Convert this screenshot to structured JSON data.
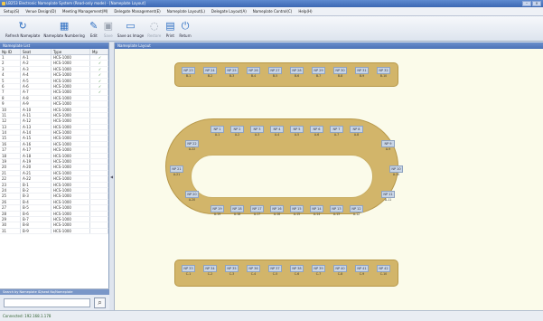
{
  "window": {
    "title": "LB253 Electronic Nameplate System (Read-only mode) - [Nameplate Layout]",
    "controls": [
      "–",
      "×"
    ]
  },
  "menu": [
    "Setup(S)",
    "Venue Design(D)",
    "Meeting Management(M)",
    "Delegate Management(E)",
    "Nameplate Layout(L)",
    "Delegate Layout(A)",
    "Nameplate Control(C)",
    "Help(H)"
  ],
  "toolbar": [
    {
      "label": "Refresh Nameplate",
      "icon": "refresh-icon",
      "glyph": "↻",
      "disabled": false
    },
    {
      "label": "Nameplate Numbering",
      "icon": "numbering-icon",
      "glyph": "▦",
      "disabled": false
    },
    {
      "label": "Edit",
      "icon": "pencil-icon",
      "glyph": "✎",
      "disabled": false
    },
    {
      "label": "Save",
      "icon": "save-icon",
      "glyph": "▣",
      "disabled": true
    },
    {
      "label": "Save as Image",
      "icon": "image-icon",
      "glyph": "▭",
      "disabled": false
    },
    {
      "label": "Restore",
      "icon": "restore-icon",
      "glyph": "◌",
      "disabled": true
    },
    {
      "label": "Print",
      "icon": "printer-icon",
      "glyph": "▤",
      "disabled": false
    },
    {
      "label": "Return",
      "icon": "power-icon",
      "glyph": "⏻",
      "disabled": false
    }
  ],
  "left_panel": {
    "title": "Nameplate List",
    "columns": [
      "Np ID",
      "Seat",
      "Type",
      "Mp"
    ],
    "rows": [
      [
        "1",
        "A-1",
        "HCS-1000",
        "✓"
      ],
      [
        "2",
        "A-2",
        "HCS-1000",
        "✓"
      ],
      [
        "3",
        "A-3",
        "HCS-1000",
        "✓"
      ],
      [
        "4",
        "A-4",
        "HCS-1000",
        "✓"
      ],
      [
        "5",
        "A-5",
        "HCS-1000",
        "✓"
      ],
      [
        "6",
        "A-6",
        "HCS-1000",
        "✓"
      ],
      [
        "7",
        "A-7",
        "HCS-1000",
        "✓"
      ],
      [
        "8",
        "A-8",
        "HCS-1000",
        ""
      ],
      [
        "9",
        "A-9",
        "HCS-1000",
        ""
      ],
      [
        "10",
        "A-10",
        "HCS-1000",
        ""
      ],
      [
        "11",
        "A-11",
        "HCS-1000",
        ""
      ],
      [
        "12",
        "A-12",
        "HCS-1000",
        ""
      ],
      [
        "13",
        "A-13",
        "HCS-1000",
        ""
      ],
      [
        "14",
        "A-14",
        "HCS-1000",
        ""
      ],
      [
        "15",
        "A-15",
        "HCS-1000",
        ""
      ],
      [
        "16",
        "A-16",
        "HCS-1000",
        ""
      ],
      [
        "17",
        "A-17",
        "HCS-1000",
        ""
      ],
      [
        "18",
        "A-18",
        "HCS-1000",
        ""
      ],
      [
        "19",
        "A-19",
        "HCS-1000",
        ""
      ],
      [
        "20",
        "A-20",
        "HCS-1000",
        ""
      ],
      [
        "21",
        "A-21",
        "HCS-1000",
        ""
      ],
      [
        "22",
        "A-22",
        "HCS-1000",
        ""
      ],
      [
        "23",
        "B-1",
        "HCS-1000",
        ""
      ],
      [
        "24",
        "B-2",
        "HCS-1000",
        ""
      ],
      [
        "25",
        "B-3",
        "HCS-1000",
        ""
      ],
      [
        "26",
        "B-4",
        "HCS-1000",
        ""
      ],
      [
        "27",
        "B-5",
        "HCS-1000",
        ""
      ],
      [
        "28",
        "B-6",
        "HCS-1000",
        ""
      ],
      [
        "29",
        "B-7",
        "HCS-1000",
        ""
      ],
      [
        "30",
        "B-8",
        "HCS-1000",
        ""
      ],
      [
        "31",
        "B-9",
        "HCS-1000",
        ""
      ]
    ],
    "search_title": "Search by Nameplate ID/seat No/Nameplate",
    "search_value": ""
  },
  "canvas": {
    "title": "Nameplate Layout",
    "top_row": [
      {
        "id": "NP 23",
        "name": "B-1"
      },
      {
        "id": "NP 24",
        "name": "B-2"
      },
      {
        "id": "NP 25",
        "name": "B-3"
      },
      {
        "id": "NP 26",
        "name": "B-4"
      },
      {
        "id": "NP 27",
        "name": "B-5"
      },
      {
        "id": "NP 28",
        "name": "B-6"
      },
      {
        "id": "NP 29",
        "name": "B-7"
      },
      {
        "id": "NP 30",
        "name": "B-8"
      },
      {
        "id": "NP 31",
        "name": "B-9"
      },
      {
        "id": "NP 32",
        "name": "B-10"
      }
    ],
    "oval_top": [
      {
        "id": "NP 1",
        "name": "A-1"
      },
      {
        "id": "NP 2",
        "name": "A-2"
      },
      {
        "id": "NP 3",
        "name": "A-3"
      },
      {
        "id": "NP 4",
        "name": "A-4"
      },
      {
        "id": "NP 5",
        "name": "A-5"
      },
      {
        "id": "NP 6",
        "name": "A-6"
      },
      {
        "id": "NP 7",
        "name": "A-7"
      },
      {
        "id": "NP 8",
        "name": "A-8"
      }
    ],
    "oval_left": [
      {
        "id": "NP 22",
        "name": "A-22"
      },
      {
        "id": "NP 21",
        "name": "A-21"
      },
      {
        "id": "NP 20",
        "name": "A-20"
      }
    ],
    "oval_right": [
      {
        "id": "NP 9",
        "name": "A-9"
      },
      {
        "id": "NP 10",
        "name": "A-10"
      },
      {
        "id": "NP 11",
        "name": "A-11"
      }
    ],
    "oval_bottom": [
      {
        "id": "NP 19",
        "name": "A-19"
      },
      {
        "id": "NP 18",
        "name": "A-18"
      },
      {
        "id": "NP 17",
        "name": "A-17"
      },
      {
        "id": "NP 16",
        "name": "A-16"
      },
      {
        "id": "NP 15",
        "name": "A-15"
      },
      {
        "id": "NP 14",
        "name": "A-14"
      },
      {
        "id": "NP 13",
        "name": "A-13"
      },
      {
        "id": "NP 12",
        "name": "A-12"
      }
    ],
    "bottom_row": [
      {
        "id": "NP 33",
        "name": "C-1"
      },
      {
        "id": "NP 34",
        "name": "C-2"
      },
      {
        "id": "NP 35",
        "name": "C-3"
      },
      {
        "id": "NP 36",
        "name": "C-4"
      },
      {
        "id": "NP 37",
        "name": "C-5"
      },
      {
        "id": "NP 38",
        "name": "C-6"
      },
      {
        "id": "NP 39",
        "name": "C-7"
      },
      {
        "id": "NP 40",
        "name": "C-8"
      },
      {
        "id": "NP 41",
        "name": "C-9"
      },
      {
        "id": "NP 42",
        "name": "C-10"
      }
    ]
  },
  "status": "Connected: 192.168.1.178"
}
